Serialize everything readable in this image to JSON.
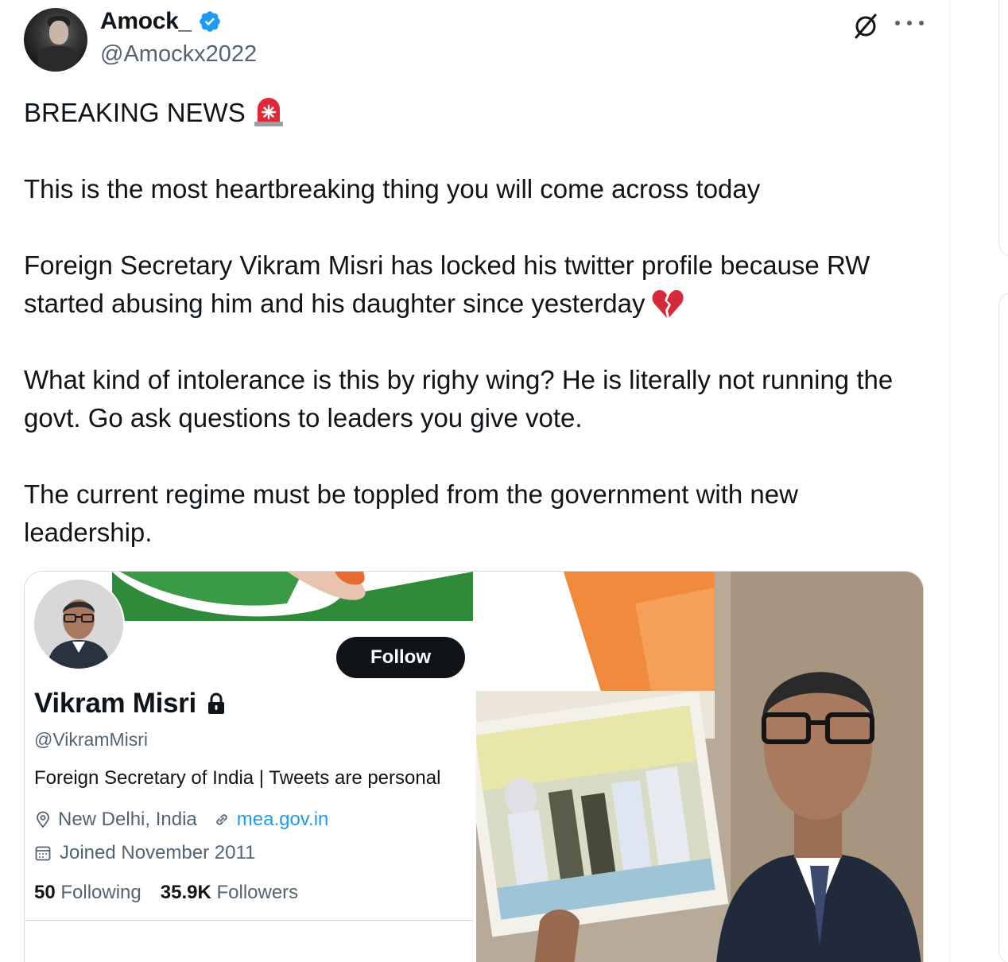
{
  "tweet": {
    "author": {
      "display_name": "Amock_",
      "handle": "@Amockx2022",
      "verified": true
    },
    "paragraphs": [
      "BREAKING NEWS",
      "This is the most heartbreaking thing you will come across today",
      "Foreign Secretary Vikram Misri has locked his twitter profile because RW started abusing him and his daughter since yesterday",
      "What kind of intolerance is this by righy wing? He is literally not running the govt. Go ask questions to leaders you give vote.",
      "The current regime must be toppled from the government with new leadership."
    ],
    "emoji": {
      "breaking_news": "siren-icon",
      "yesterday": "broken-heart-icon"
    }
  },
  "embedded_profile": {
    "follow_label": "Follow",
    "name": "Vikram Misri",
    "handle": "@VikramMisri",
    "bio": "Foreign Secretary of India | Tweets are personal",
    "location": "New Delhi, India",
    "website": "mea.gov.in",
    "joined": "Joined November 2011",
    "following_count": "50",
    "following_label": "Following",
    "followers_count": "35.9K",
    "followers_label": "Followers"
  },
  "colors": {
    "text": "#0f1419",
    "muted": "#536471",
    "accent": "#1d9bf0",
    "border": "#cfd9de"
  }
}
